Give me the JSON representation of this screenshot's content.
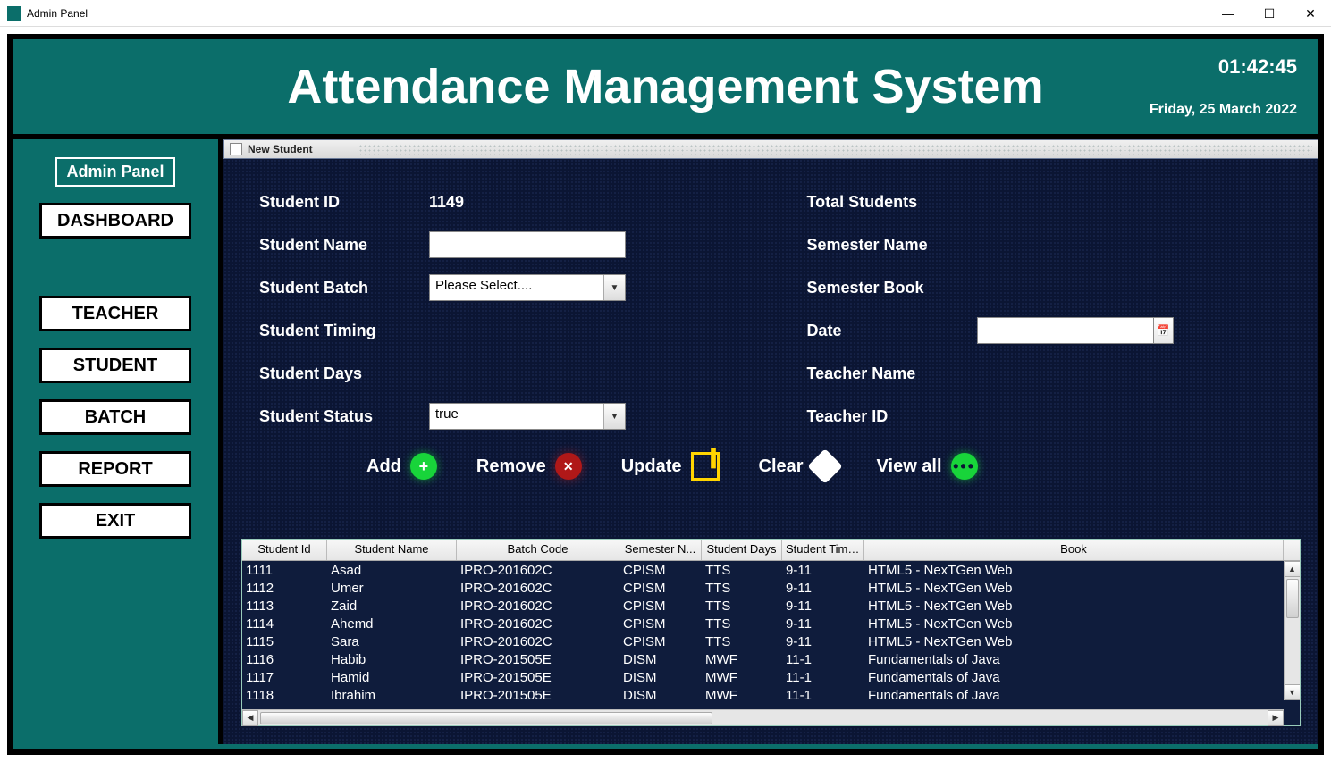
{
  "window": {
    "title": "Admin Panel"
  },
  "header": {
    "title": "Attendance Management System",
    "time": "01:42:45",
    "date": "Friday, 25 March 2022"
  },
  "sidebar": {
    "title": "Admin Panel",
    "items": [
      {
        "label": "DASHBOARD"
      },
      {
        "label": "TEACHER"
      },
      {
        "label": "STUDENT"
      },
      {
        "label": "BATCH"
      },
      {
        "label": "REPORT"
      },
      {
        "label": "EXIT"
      }
    ]
  },
  "mdi": {
    "title": "New Student"
  },
  "form": {
    "labels": {
      "student_id": "Student ID",
      "student_name": "Student Name",
      "student_batch": "Student Batch",
      "student_timing": "Student Timing",
      "student_days": "Student Days",
      "student_status": "Student Status",
      "total_students": "Total Students",
      "semester_name": "Semester Name",
      "semester_book": "Semester Book",
      "date": "Date",
      "teacher_name": "Teacher Name",
      "teacher_id": "Teacher ID"
    },
    "values": {
      "student_id": "1149",
      "student_name": "",
      "student_batch_placeholder": "Please Select....",
      "student_status": "true",
      "date": ""
    }
  },
  "actions": {
    "add": "Add",
    "remove": "Remove",
    "update": "Update",
    "clear": "Clear",
    "viewall": "View all"
  },
  "grid": {
    "columns": [
      "Student Id",
      "Student Name",
      "Batch Code",
      "Semester N...",
      "Student Days",
      "Student Timi...",
      "Book"
    ],
    "rows": [
      [
        "1111",
        "Asad",
        "IPRO-201602C",
        "CPISM",
        "TTS",
        "9-11",
        "HTML5 - NexTGen Web"
      ],
      [
        "1112",
        "Umer",
        "IPRO-201602C",
        "CPISM",
        "TTS",
        "9-11",
        "HTML5 - NexTGen Web"
      ],
      [
        "1113",
        "Zaid",
        "IPRO-201602C",
        "CPISM",
        "TTS",
        "9-11",
        "HTML5 - NexTGen Web"
      ],
      [
        "1114",
        "Ahemd",
        "IPRO-201602C",
        "CPISM",
        "TTS",
        "9-11",
        "HTML5 - NexTGen Web"
      ],
      [
        "1115",
        "Sara",
        "IPRO-201602C",
        "CPISM",
        "TTS",
        "9-11",
        "HTML5 - NexTGen Web"
      ],
      [
        "1116",
        "Habib",
        "IPRO-201505E",
        "DISM",
        "MWF",
        "11-1",
        "Fundamentals of Java"
      ],
      [
        "1117",
        "Hamid",
        "IPRO-201505E",
        "DISM",
        "MWF",
        "11-1",
        "Fundamentals of Java"
      ],
      [
        "1118",
        "Ibrahim",
        "IPRO-201505E",
        "DISM",
        "MWF",
        "11-1",
        "Fundamentals of Java"
      ]
    ]
  }
}
